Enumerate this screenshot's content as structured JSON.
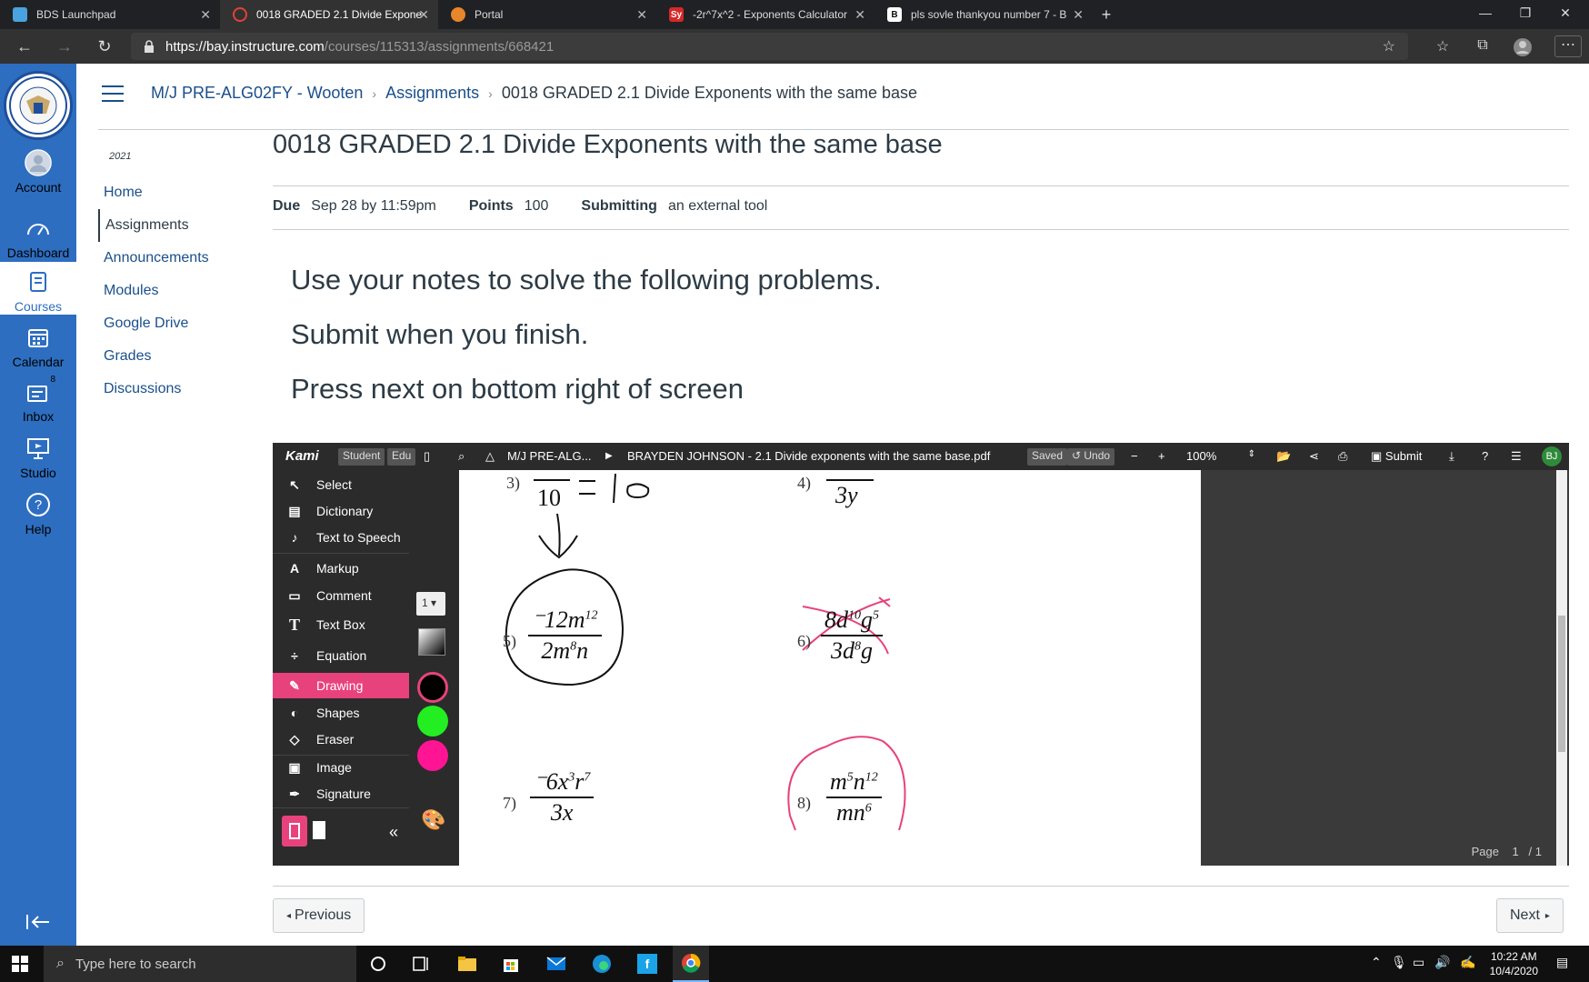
{
  "browser": {
    "tabs": [
      {
        "label": "BDS Launchpad",
        "icon": "launchpad-icon",
        "color": "#4aa3df"
      },
      {
        "label": "0018 GRADED 2.1 Divide Expone",
        "icon": "canvas-icon",
        "color": "#e34234",
        "active": true
      },
      {
        "label": "Portal",
        "icon": "portal-icon",
        "color": "#e8862a"
      },
      {
        "label": "-2r^7x^2 - Exponents Calculator",
        "icon": "symbolab-icon",
        "color": "#d62828"
      },
      {
        "label": "pls sovle thankyou number 7 - B",
        "icon": "brainly-icon",
        "color": "#111111"
      }
    ],
    "url_host": "https://bay.instructure.com",
    "url_path": "/courses/115313/assignments/668421"
  },
  "global_nav": {
    "items": [
      {
        "label": "Account",
        "icon": "account-icon"
      },
      {
        "label": "Dashboard",
        "icon": "dashboard-icon"
      },
      {
        "label": "Courses",
        "icon": "courses-icon"
      },
      {
        "label": "Calendar",
        "icon": "calendar-icon"
      },
      {
        "label": "Inbox",
        "icon": "inbox-icon",
        "badge": "8"
      },
      {
        "label": "Studio",
        "icon": "studio-icon"
      },
      {
        "label": "Help",
        "icon": "help-icon"
      }
    ]
  },
  "breadcrumbs": {
    "course": "M/J PRE-ALG02FY - Wooten",
    "section": "Assignments",
    "current": "0018 GRADED 2.1 Divide Exponents with the same base"
  },
  "course_nav": {
    "term": "2021",
    "items": [
      "Home",
      "Assignments",
      "Announcements",
      "Modules",
      "Google Drive",
      "Grades",
      "Discussions"
    ]
  },
  "assignment": {
    "title": "0018 GRADED 2.1 Divide Exponents with the same base",
    "due_label": "Due",
    "due_value": "Sep 28 by 11:59pm",
    "points_label": "Points",
    "points_value": "100",
    "submitting_label": "Submitting",
    "submitting_value": "an external tool",
    "instructions": [
      "Use your notes to solve the following problems.",
      "Submit when you finish.",
      "Press next on bottom right of screen"
    ]
  },
  "kami": {
    "brand": "Kami",
    "badge_student": "Student",
    "badge_edu": "Edu",
    "folder": "M/J PRE-ALG...",
    "filename": "BRAYDEN JOHNSON - 2.1 Divide exponents with the same base.pdf",
    "saved": "Saved",
    "undo": "Undo",
    "zoom": "100%",
    "submit": "Submit",
    "avatar": "BJ",
    "tools": [
      "Select",
      "Dictionary",
      "Text to Speech",
      "Markup",
      "Comment",
      "Text Box",
      "Equation",
      "Drawing",
      "Shapes",
      "Eraser",
      "Image",
      "Signature"
    ],
    "active_tool": "Drawing",
    "stroke_size": "1",
    "colors": [
      "#000000",
      "#22ee22",
      "#ff1493"
    ],
    "page_label": "Page",
    "page_current": "1",
    "page_total": "/ 1"
  },
  "worksheet": {
    "p3_label": "3)",
    "p3_den": "10",
    "p4_label": "4)",
    "p4_den": "3y",
    "p5_label": "5)",
    "p5_num": "⁻12m",
    "p5_num_exp": "12",
    "p5_den": "2m",
    "p5_den_exp": "8",
    "p5_den_tail": "n",
    "p6_label": "6)",
    "p6_num": "8d",
    "p6_num_exp": "10",
    "p6_num_tail": "g",
    "p6_num_tail_exp": "5",
    "p6_den": "3d",
    "p6_den_exp": "8",
    "p6_den_tail": "g",
    "p7_label": "7)",
    "p7_num": "⁻6x",
    "p7_num_exp": "3",
    "p7_num_tail": "r",
    "p7_num_tail_exp": "7",
    "p7_den": "3x",
    "p8_label": "8)",
    "p8_num": "m",
    "p8_num_exp": "5",
    "p8_num_tail": "n",
    "p8_num_tail_exp": "12",
    "p8_den": "mn",
    "p8_den_exp": "6"
  },
  "footer": {
    "previous": "Previous",
    "next": "Next"
  },
  "taskbar": {
    "search_placeholder": "Type here to search",
    "time": "10:22 AM",
    "date": "10/4/2020"
  }
}
